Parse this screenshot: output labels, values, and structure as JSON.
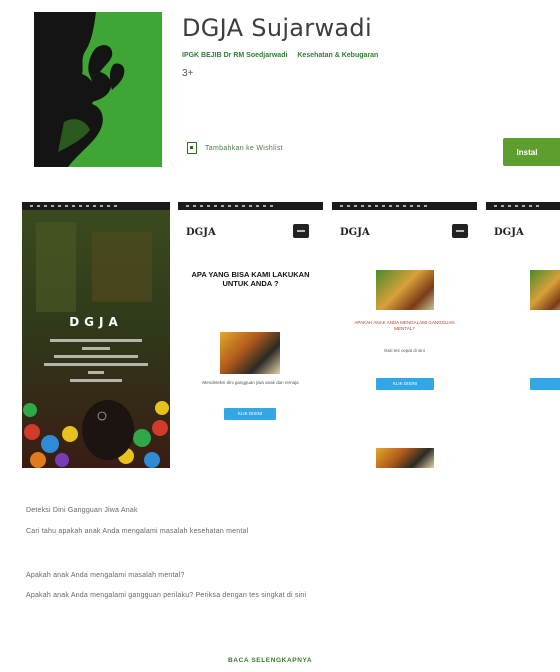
{
  "app": {
    "title": "DGJA Sujarwadi",
    "developer": "IPGK BEJIB Dr RM Soedjarwadi",
    "category": "Kesehatan & Kebugaran",
    "age_rating": "3+",
    "wishlist_label": "Tambahkan ke Wishlist",
    "install_label": "Instal"
  },
  "colors": {
    "brand_green": "#3fa535",
    "install_green": "#5d9e2f",
    "link_green": "#3a7a2a",
    "blue_button": "#33a7e6"
  },
  "icons": {
    "app_icon": "hand-silhouette-icon",
    "wishlist": "bookmark-icon"
  },
  "screenshots": {
    "shot1": {
      "logo": "DGJA"
    },
    "shot2": {
      "logo": "DGJA",
      "heading": "APA YANG BISA KAMI LAKUKAN UNTUK ANDA ?",
      "caption": "Mendeteksi dini gangguan jiwa anak dan remaja",
      "button": "KLIK DISINI"
    },
    "shot3": {
      "logo": "DGJA",
      "caption_red": "APAKAH ANAK ANDA MENGALAMI GANGGUAN MENTAL?",
      "caption": "Ikuti tes cepat di sini",
      "button": "KLIK DISINI"
    },
    "shot4": {
      "logo": "DGJA"
    }
  },
  "description": {
    "line1": "Deteksi Dini Gangguan Jiwa Anak",
    "line2": "Cari tahu apakah anak Anda mengalami masalah kesehatan mental",
    "line3": "Apakah anak Anda mengalami masalah mental?",
    "line4": "Apakah anak Anda mengalami gangguan perilaku? Periksa dengan tes singkat di sini",
    "read_more": "BACA SELENGKAPNYA"
  }
}
